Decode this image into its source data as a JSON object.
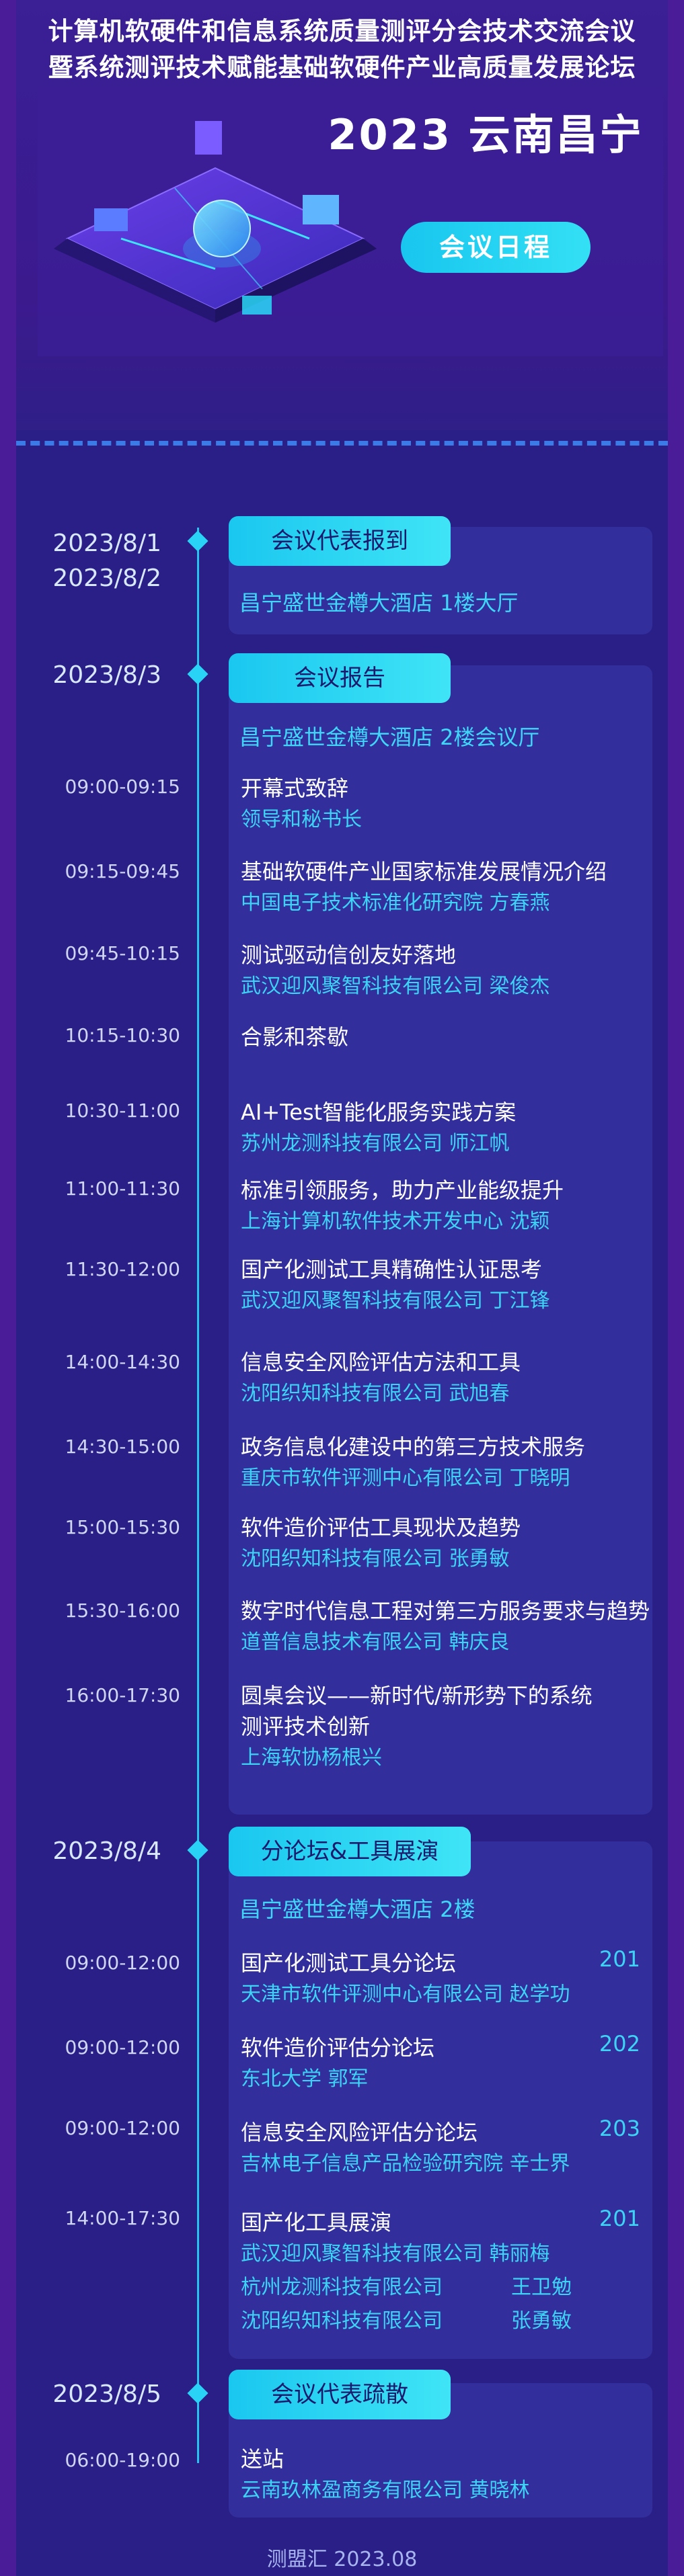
{
  "header": {
    "title_line1": "计算机软硬件和信息系统质量测评分会技术交流会议",
    "title_line2": "暨系统测评技术赋能基础软硬件产业高质量发展论坛",
    "main_title": "2023 云南昌宁",
    "agenda_button": "会议日程"
  },
  "sessions": [
    {
      "dates": [
        "2023/8/1",
        "2023/8/2"
      ],
      "tab": "会议代表报到",
      "venue": "昌宁盛世金樽大酒店 1楼大厅",
      "items": []
    },
    {
      "dates": [
        "2023/8/3"
      ],
      "tab": "会议报告",
      "venue": "昌宁盛世金樽大酒店 2楼会议厅",
      "items": [
        {
          "time": "09:00-09:15",
          "title": "开幕式致辞",
          "speaker": "领导和秘书长"
        },
        {
          "time": "09:15-09:45",
          "title": "基础软硬件产业国家标准发展情况介绍",
          "speaker": "中国电子技术标准化研究院 方春燕"
        },
        {
          "time": "09:45-10:15",
          "title": "测试驱动信创友好落地",
          "speaker": "武汉迎风聚智科技有限公司 梁俊杰"
        },
        {
          "time": "10:15-10:30",
          "title": "合影和茶歇",
          "speaker": ""
        },
        {
          "time": "10:30-11:00",
          "title": "AI+Test智能化服务实践方案",
          "speaker": "苏州龙测科技有限公司 师江帆"
        },
        {
          "time": "11:00-11:30",
          "title": "标准引领服务，助力产业能级提升",
          "speaker": "上海计算机软件技术开发中心 沈颖"
        },
        {
          "time": "11:30-12:00",
          "title": "国产化测试工具精确性认证思考",
          "speaker": "武汉迎风聚智科技有限公司 丁江锋"
        },
        {
          "time": "14:00-14:30",
          "title": "信息安全风险评估方法和工具",
          "speaker": "沈阳织知科技有限公司 武旭春"
        },
        {
          "time": "14:30-15:00",
          "title": "政务信息化建设中的第三方技术服务",
          "speaker": "重庆市软件评测中心有限公司 丁晓明"
        },
        {
          "time": "15:00-15:30",
          "title": "软件造价评估工具现状及趋势",
          "speaker": "沈阳织知科技有限公司 张勇敏"
        },
        {
          "time": "15:30-16:00",
          "title": "数字时代信息工程对第三方服务要求与趋势",
          "speaker": "道普信息技术有限公司 韩庆良"
        },
        {
          "time": "16:00-17:30",
          "title": "圆桌会议——新时代/新形势下的系统",
          "title2": "测评技术创新",
          "speaker": "上海软协杨根兴"
        }
      ]
    },
    {
      "dates": [
        "2023/8/4"
      ],
      "tab": "分论坛&工具展演",
      "venue": "昌宁盛世金樽大酒店 2楼",
      "items": [
        {
          "time": "09:00-12:00",
          "title": "国产化测试工具分论坛",
          "room": "201",
          "speakers": [
            "天津市软件评测中心有限公司 赵学功"
          ]
        },
        {
          "time": "09:00-12:00",
          "title": "软件造价评估分论坛",
          "room": "202",
          "speakers": [
            "东北大学 郭军"
          ]
        },
        {
          "time": "09:00-12:00",
          "title": "信息安全风险评估分论坛",
          "room": "203",
          "speakers": [
            "吉林电子信息产品检验研究院 辛士界"
          ]
        },
        {
          "time": "14:00-17:30",
          "title": "国产化工具展演",
          "room": "201",
          "speakers": [
            "武汉迎风聚智科技有限公司 韩丽梅",
            "杭州龙测科技有限公司",
            "沈阳织知科技有限公司"
          ],
          "speaker_names": [
            "",
            "王卫勉",
            "张勇敏"
          ]
        }
      ]
    },
    {
      "dates": [
        "2023/8/5"
      ],
      "tab": "会议代表疏散",
      "items": [
        {
          "time": "06:00-19:00",
          "title": "送站",
          "speaker": "云南玖林盈商务有限公司 黄晓林"
        }
      ]
    }
  ],
  "footer": "测盟汇 2023.08"
}
